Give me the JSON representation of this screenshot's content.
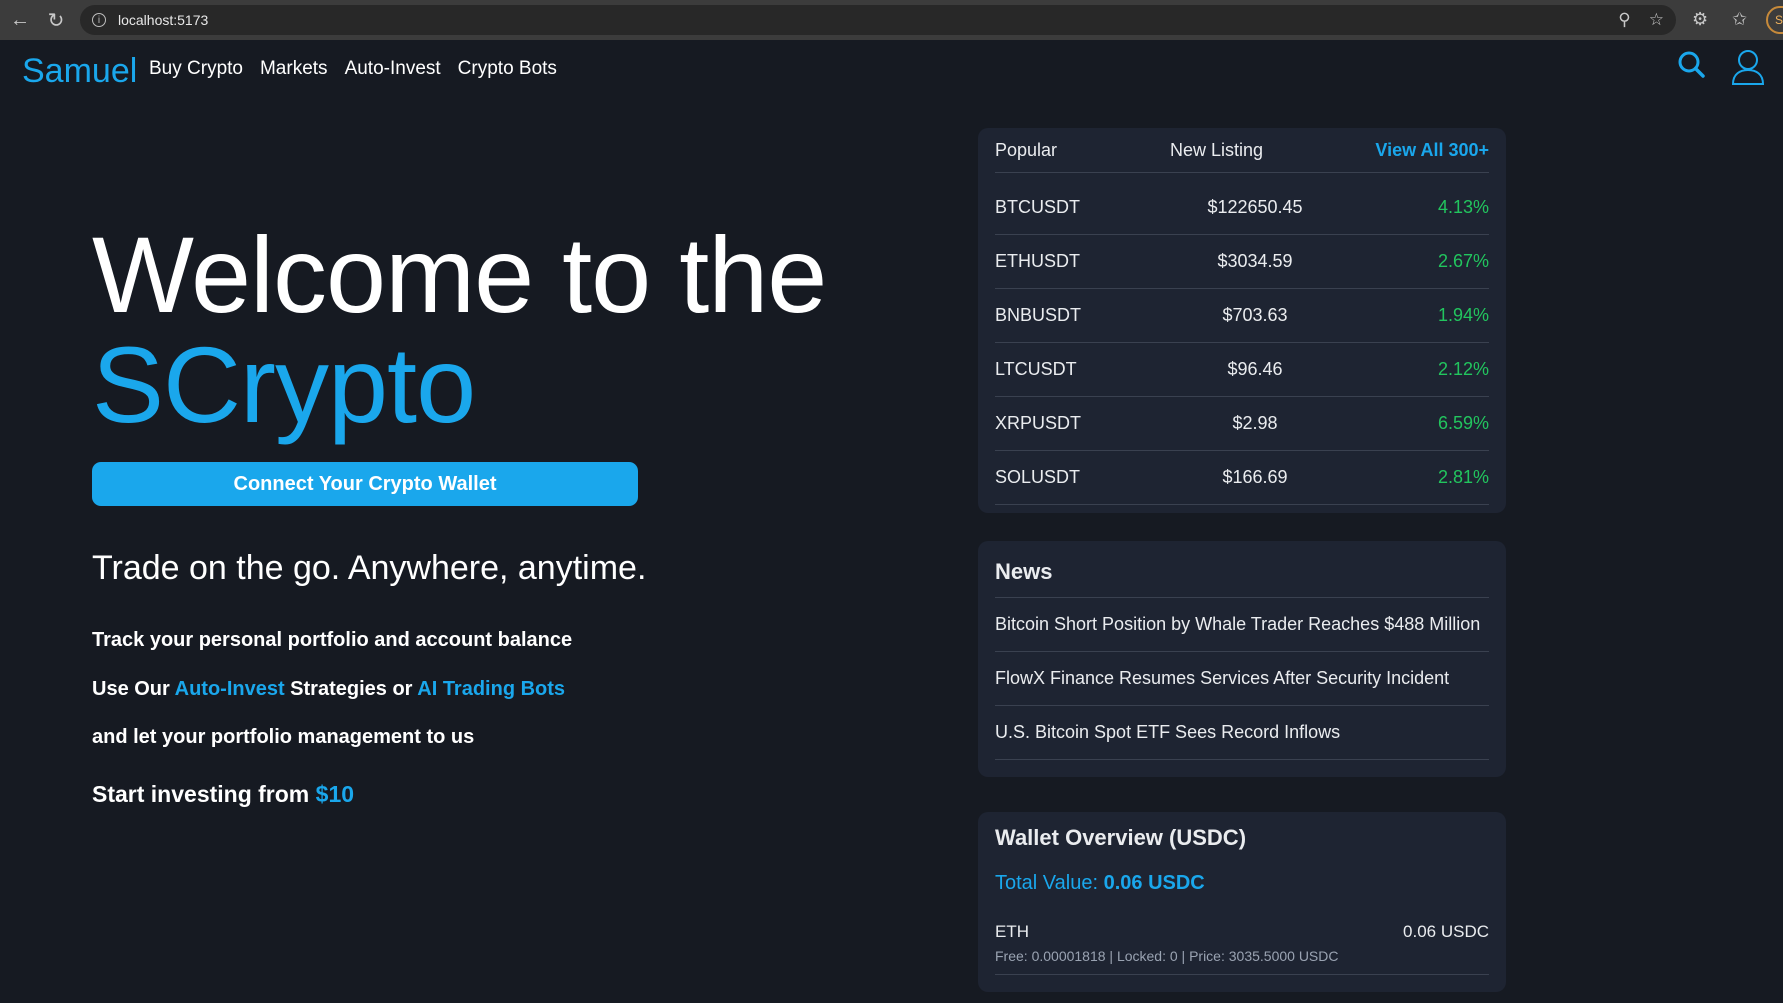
{
  "browser": {
    "url": "localhost:5173",
    "profile_initials": "Si"
  },
  "header": {
    "logo": "Samuel",
    "nav": [
      "Buy Crypto",
      "Markets",
      "Auto-Invest",
      "Crypto Bots"
    ]
  },
  "hero": {
    "title_line1": "Welcome to the",
    "title_line2": "SCrypto",
    "connect_button": "Connect Your Crypto Wallet",
    "tagline": "Trade on the go. Anywhere, anytime.",
    "line1": "Track your personal portfolio and account balance",
    "line2_prefix": "Use Our ",
    "line2_link1": "Auto-Invest",
    "line2_middle": " Strategies or ",
    "line2_link2": "AI Trading Bots",
    "line3": "and let your portfolio management to us",
    "start_prefix": "Start investing from ",
    "start_amount": "$10"
  },
  "market": {
    "tab_popular": "Popular",
    "tab_new": "New Listing",
    "view_all": "View All 300+",
    "rows": [
      {
        "symbol": "BTCUSDT",
        "price": "$122650.45",
        "change": "4.13%"
      },
      {
        "symbol": "ETHUSDT",
        "price": "$3034.59",
        "change": "2.67%"
      },
      {
        "symbol": "BNBUSDT",
        "price": "$703.63",
        "change": "1.94%"
      },
      {
        "symbol": "LTCUSDT",
        "price": "$96.46",
        "change": "2.12%"
      },
      {
        "symbol": "XRPUSDT",
        "price": "$2.98",
        "change": "6.59%"
      },
      {
        "symbol": "SOLUSDT",
        "price": "$166.69",
        "change": "2.81%"
      }
    ]
  },
  "news": {
    "title": "News",
    "items": [
      "Bitcoin Short Position by Whale Trader Reaches $488 Million",
      "FlowX Finance Resumes Services After Security Incident",
      "U.S. Bitcoin Spot ETF Sees Record Inflows"
    ]
  },
  "wallet": {
    "title": "Wallet Overview (USDC)",
    "total_label": "Total Value: ",
    "total_value": "0.06 USDC",
    "asset": "ETH",
    "amount": "0.06 USDC",
    "detail": "Free: 0.00001818 | Locked: 0 | Price: 3035.5000 USDC"
  },
  "colors": {
    "background": "#161a22",
    "accent": "#1aa7ec",
    "positive": "#22c55e",
    "card": "#1e2432"
  }
}
